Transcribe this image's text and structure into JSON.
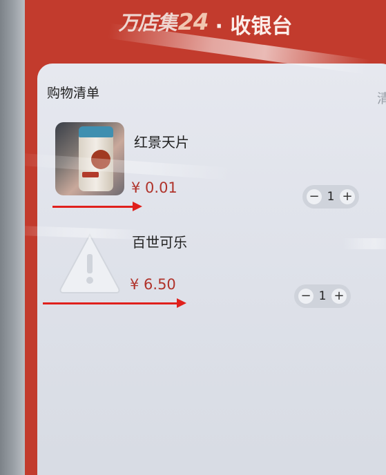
{
  "header": {
    "brand_text": "万店集",
    "brand_number": "24",
    "title": "· 收银台"
  },
  "cart": {
    "title": "购物清单",
    "clear_label": "清空",
    "items": [
      {
        "name": "红景天片",
        "price": "¥ 0.01",
        "quantity": "1",
        "image": "product-photo"
      },
      {
        "name": "百世可乐",
        "price": "¥ 6.50",
        "quantity": "1",
        "image": "warning-placeholder-icon"
      }
    ]
  },
  "stepper": {
    "minus": "−",
    "plus": "+"
  },
  "colors": {
    "header_red": "#c23b2d",
    "price_red": "#b0332b",
    "annotation_arrow": "#e0201c",
    "panel_bg": "#e1e4eb"
  }
}
